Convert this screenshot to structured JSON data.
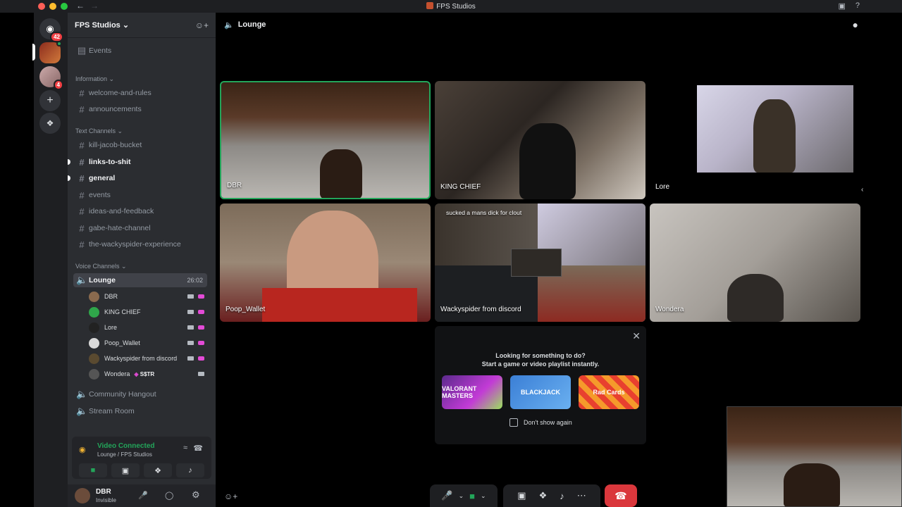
{
  "window": {
    "title": "FPS Studios"
  },
  "guilds": [
    {
      "name": "discord-home-icon",
      "badge": "42"
    },
    {
      "name": "server-1",
      "badge": ""
    },
    {
      "name": "server-2",
      "badge": "4"
    }
  ],
  "server": {
    "name": "FPS Studios"
  },
  "sidebar": {
    "events": "Events",
    "categories": {
      "information": "Information",
      "text": "Text Channels",
      "voice": "Voice Channels"
    },
    "info_channels": [
      "welcome-and-rules",
      "announcements"
    ],
    "text_channels": [
      "kill-jacob-bucket",
      "links-to-shit",
      "general",
      "events",
      "ideas-and-feedback",
      "gabe-hate-channel",
      "the-wackyspider-experience"
    ],
    "voice_channels": {
      "lounge": {
        "name": "Lounge",
        "timer": "26:02"
      },
      "community": "Community Hangout",
      "stream": "Stream Room"
    },
    "voice_users": [
      {
        "name": "DBR",
        "color": "#8a6a4e"
      },
      {
        "name": "KING CHIEF",
        "color": "#2fa64a"
      },
      {
        "name": "Lore",
        "color": "#222222"
      },
      {
        "name": "Poop_Wallet",
        "color": "#d9d9d9"
      },
      {
        "name": "Wackyspider from discord",
        "color": "#5a4a30"
      },
      {
        "name": "Wondera",
        "color": "#555555",
        "tag": "S$TR"
      }
    ]
  },
  "voice_panel": {
    "title": "Video Connected",
    "subtitle": "Lounge / FPS Studios"
  },
  "user": {
    "name": "DBR",
    "status": "Invisible"
  },
  "main": {
    "channel": "Lounge"
  },
  "tiles": {
    "dbr": "DBR",
    "king": "KING CHIEF",
    "lore": "Lore",
    "poop": "Poop_Wallet",
    "wacky": "Wackyspider from discord",
    "wacky_overlay": "sucked a mans dick for clout",
    "wondera": "Wondera"
  },
  "activity": {
    "line1": "Looking for something to do?",
    "line2": "Start a game or video playlist instantly.",
    "cards": [
      "VALORANT MASTERS",
      "BLACKJACK",
      "Rad Cards"
    ],
    "checkbox_label": "Don't show again"
  },
  "colors": {
    "accent": "#23a55a",
    "danger": "#da373c",
    "bg": "#2b2d31"
  }
}
